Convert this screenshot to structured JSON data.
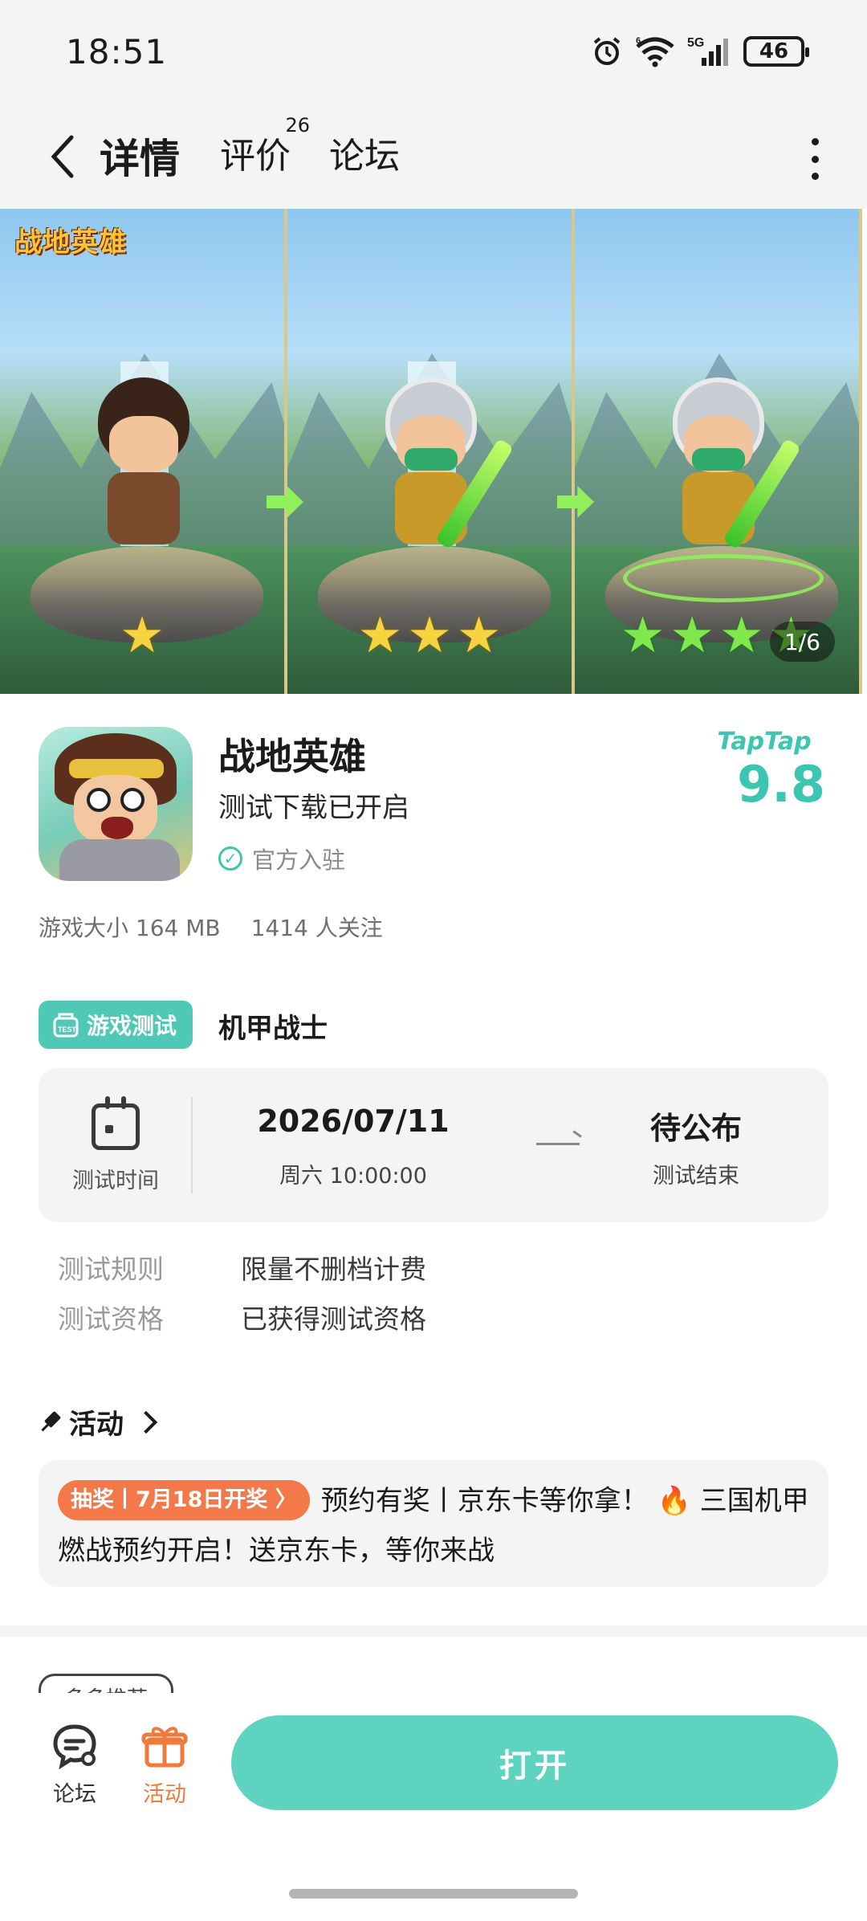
{
  "status_bar": {
    "time": "18:51",
    "battery": "46",
    "network": "5G",
    "wifi_superscript": "6",
    "icons": [
      "alarm-icon",
      "wifi-icon",
      "signal-icon",
      "battery-icon"
    ]
  },
  "header": {
    "tabs": [
      {
        "label": "详情",
        "active": true
      },
      {
        "label": "评价",
        "count": "26"
      },
      {
        "label": "论坛"
      }
    ],
    "icons": [
      "back-arrow-icon",
      "more-vertical-icon"
    ]
  },
  "banner": {
    "logo_text": "战地英雄",
    "counter": "1/6",
    "stars": [
      1,
      3,
      4
    ]
  },
  "app": {
    "name": "战地英雄",
    "subtitle": "测试下载已开启",
    "official_label": "官方入驻",
    "rating_brand": "TapTap",
    "rating_score": "9.8",
    "size": "游戏大小 164 MB",
    "followers": "1414 人关注"
  },
  "test": {
    "tag": "游戏测试",
    "name": "机甲战士",
    "time_label": "测试时间",
    "start_date": "2026/07/11",
    "start_weekday_time": "周六  10:00:00",
    "end_main": "待公布",
    "end_label": "测试结束",
    "rules": [
      {
        "key": "测试规则",
        "value": "限量不删档计费"
      },
      {
        "key": "测试资格",
        "value": "已获得测试资格"
      }
    ]
  },
  "activity": {
    "title": "活动",
    "badge": "抽奖丨7月18日开奖 〉",
    "text": "预约有奖丨京东卡等你拿！ 🔥 三国机甲燃战预约开启！送京东卡，等你来战"
  },
  "peek_label": "多多推荐",
  "bottom_nav": {
    "items": [
      {
        "label": "论坛",
        "icon": "forum-icon"
      },
      {
        "label": "活动",
        "icon": "gift-icon"
      }
    ],
    "open_button": "打开"
  },
  "colors": {
    "accent": "#5ed4c0",
    "activity_orange": "#f07a3c",
    "badge_orange": "#f4794a"
  }
}
